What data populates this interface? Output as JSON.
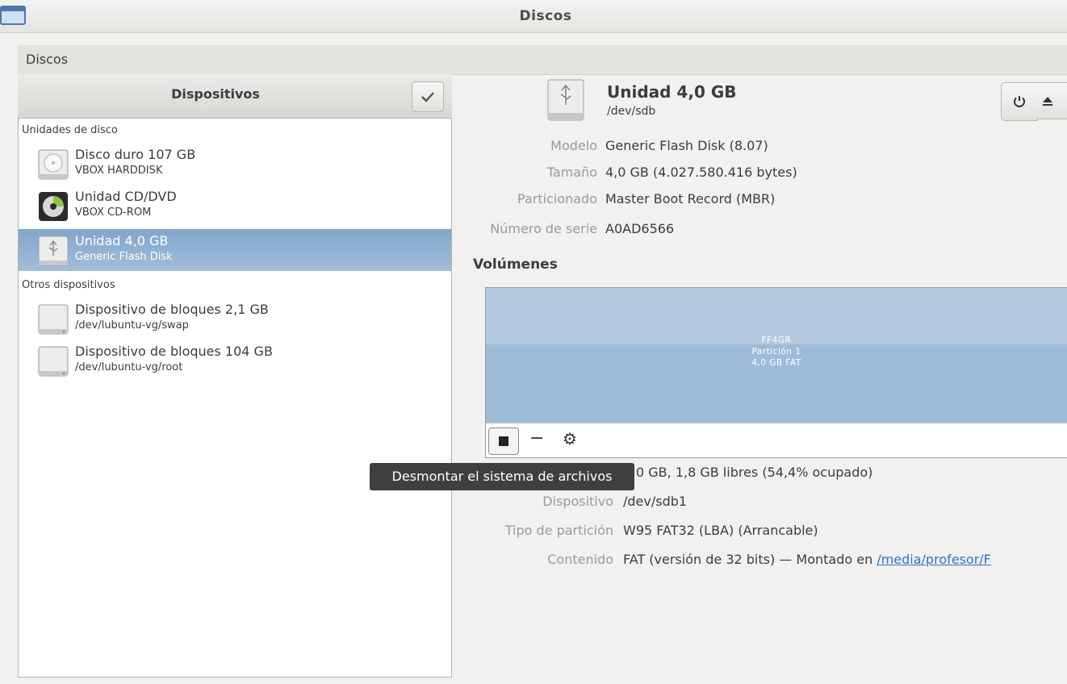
{
  "window": {
    "title": "Discos",
    "icon": "window-icon"
  },
  "header": {
    "app_name": "Discos"
  },
  "sidebar": {
    "title": "Dispositivos",
    "sections": [
      {
        "label": "Unidades de disco",
        "items": [
          {
            "name": "Disco duro 107 GB",
            "sub": "VBOX HARDDISK",
            "icon": "harddisk-icon",
            "selected": false
          },
          {
            "name": "Unidad CD/DVD",
            "sub": "VBOX CD-ROM",
            "icon": "optical-disc-icon",
            "selected": false
          },
          {
            "name": "Unidad 4,0 GB",
            "sub": "Generic Flash Disk",
            "icon": "usb-drive-icon",
            "selected": true
          }
        ]
      },
      {
        "label": "Otros dispositivos",
        "items": [
          {
            "name": "Dispositivo de bloques 2,1 GB",
            "sub": "/dev/lubuntu-vg/swap",
            "icon": "block-device-icon",
            "selected": false
          },
          {
            "name": "Dispositivo de bloques 104 GB",
            "sub": "/dev/lubuntu-vg/root",
            "icon": "block-device-icon",
            "selected": false
          }
        ]
      }
    ]
  },
  "disk": {
    "title": "Unidad 4,0 GB",
    "path": "/dev/sdb",
    "props": [
      {
        "label": "Modelo",
        "value": "Generic Flash Disk (8.07)"
      },
      {
        "label": "Tamaño",
        "value": "4,0 GB (4.027.580.416 bytes)"
      },
      {
        "label": "Particionado",
        "value": "Master Boot Record (MBR)"
      },
      {
        "label": "Número de serie",
        "value": "A0AD6566"
      }
    ]
  },
  "volumes": {
    "title": "Volúmenes",
    "partition": {
      "label": "FF4GR",
      "name": "Partición 1",
      "size": "4,0 GB FAT"
    },
    "props": [
      {
        "label": "",
        "value": "0 GB, 1,8 GB libres (54,4% ocupado)"
      },
      {
        "label": "Dispositivo",
        "value": "/dev/sdb1"
      },
      {
        "label": "Tipo de partición",
        "value": "W95 FAT32 (LBA) (Arrancable)"
      },
      {
        "label": "Contenido",
        "value": "FAT (versión de 32 bits) — Montado en",
        "link": "/media/profesor/F"
      }
    ]
  },
  "tooltip": {
    "text": "Desmontar el sistema de archivos"
  },
  "colors": {
    "selection": "#8fb0d3",
    "partition": "#9ebbd8",
    "link": "#2a78c8",
    "tooltip_bg": "#3f3f3f"
  }
}
